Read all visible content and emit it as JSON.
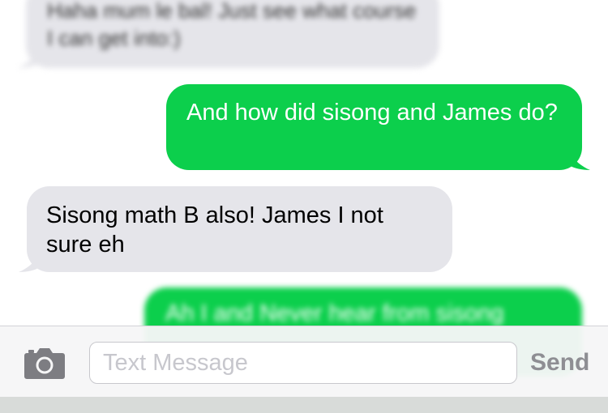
{
  "conversation": {
    "messages": [
      {
        "direction": "received",
        "text": "Haha mum le bal! Just see what course I can get into:)",
        "blurred": true
      },
      {
        "direction": "sent",
        "text": "And how did sisong and James do?",
        "blurred": false
      },
      {
        "direction": "received",
        "text": "Sisong math B also! James I not sure eh",
        "blurred": false
      },
      {
        "direction": "sent",
        "text": "Ah I and Never hear from sisong",
        "blurred": true
      }
    ]
  },
  "composer": {
    "camera_icon": "camera-icon",
    "placeholder": "Text Message",
    "value": "",
    "send_label": "Send"
  },
  "colors": {
    "sent_bubble": "#0ccf4c",
    "received_bubble": "#e5e5ea",
    "send_disabled": "#8e8e93"
  }
}
